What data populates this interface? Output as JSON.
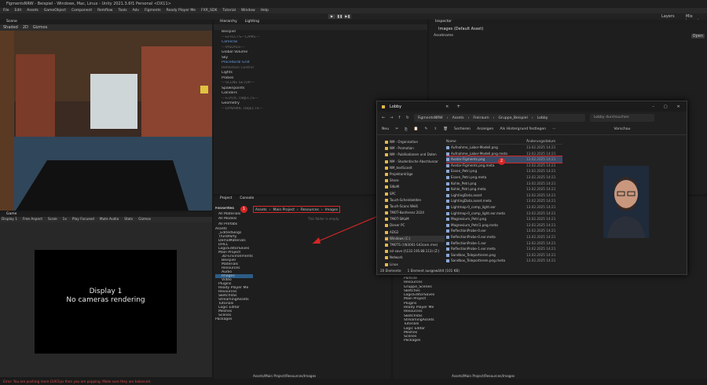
{
  "window": {
    "title": "FigmentsNRW - Beispiel - Windows, Mac, Linux - Unity 2021.3.6f1 Personal <DX11>"
  },
  "menu": [
    "File",
    "Edit",
    "Assets",
    "GameObject",
    "Component",
    "Remflow",
    "Tools",
    "Adv",
    "Figments",
    "Ready Player Me",
    "FXR_SDK",
    "Tutorial",
    "Window",
    "Help"
  ],
  "toolbar": {
    "layers_label": "Layers",
    "layout_label": "Mix Layout"
  },
  "scene": {
    "tab": "Scene",
    "toolbar_items": [
      "Shaded",
      "2D",
      "Gizmos"
    ]
  },
  "game": {
    "tab": "Game",
    "display": "Display 1",
    "aspect": "Free Aspect",
    "scale_label": "Scale",
    "scale_value": "1x",
    "options": [
      "Play Focused",
      "Mute Audio",
      "Stats",
      "Gizmos"
    ],
    "message_line1": "Display 1",
    "message_line2": "No cameras rendering"
  },
  "hierarchy": {
    "tab": "Hierarchy",
    "tab2": "Lighting",
    "items": [
      {
        "label": "Beispiel",
        "cls": ""
      },
      {
        "label": "---EFFECTS---CAMS---",
        "cls": "muted"
      },
      {
        "label": "Cameras",
        "cls": "blue"
      },
      {
        "label": "---VISUALS---",
        "cls": "muted"
      },
      {
        "label": "Global Volume",
        "cls": ""
      },
      {
        "label": "Sky",
        "cls": ""
      },
      {
        "label": "Procedural Grid",
        "cls": "blue"
      },
      {
        "label": "Reflection Control",
        "cls": "muted"
      },
      {
        "label": "Lights",
        "cls": ""
      },
      {
        "label": "Probes",
        "cls": ""
      },
      {
        "label": "---SCENE SETUP---",
        "cls": "muted"
      },
      {
        "label": "Spawnpoints",
        "cls": ""
      },
      {
        "label": "Colliders",
        "cls": ""
      },
      {
        "label": "---STATIC OBJECTS---",
        "cls": "muted"
      },
      {
        "label": "Geometry",
        "cls": ""
      },
      {
        "label": "---DYNAMIC OBJECTS---",
        "cls": "muted"
      }
    ]
  },
  "inspector": {
    "tab": "Inspector",
    "asset_title": "Images (Default Asset)",
    "open_button": "Open",
    "sub_label": "Assetname"
  },
  "project": {
    "tab": "Project",
    "tab2": "Console",
    "favorites_label": "Favorites",
    "favorites": [
      "All Materials",
      "All Models",
      "All Prefabs"
    ],
    "tree": [
      "Assets",
      "_EditedSlogs",
      "ThirdParty",
      "DemoMaterials",
      "DHLL",
      "LogicEditorSaves",
      "Main Project",
      "3D-Environments",
      "Beispiel",
      "Materials",
      "Resources",
      "Audio",
      "Images",
      "Video",
      "Plugins",
      "Ready Player Me",
      "Resources",
      "SketchVas",
      "StreamingAssets",
      "Tutorials",
      "Logic Editor",
      "Meshes",
      "Scenes",
      "Packages"
    ],
    "breadcrumb": [
      "Assets",
      "Main Project",
      "Resources",
      "Images"
    ],
    "empty_msg": "This folder is empty",
    "status_path": "Assets/Main Project/Resources/Images"
  },
  "project2": {
    "tree": [
      "Particle",
      "Resources",
      "Gruppe_Scenes",
      "Sketches",
      "LogicEditorSaves",
      "Main Project",
      "Plugins",
      "Ready Player Me",
      "Resources",
      "SketchVas",
      "StreamingAssets",
      "Tutorials",
      "Logic Editor",
      "Meshes",
      "Scenes",
      "Packages"
    ],
    "status_path": "Assets/Main Project/Resources/Images"
  },
  "explorer": {
    "tab_title": "Lobby",
    "path": [
      "FigmentsNRW",
      "Assets",
      "Freiraum",
      "Gruppe_Beispiel",
      "Lobby"
    ],
    "search_placeholder": "Lobby durchsuchen",
    "new_label": "Neu",
    "sort_label": "Sortieren",
    "view_label": "Anzeigen",
    "wallpaper_label": "Als Hintergrund festlegen",
    "preview_label": "Vorschau",
    "col_name": "Name",
    "col_date": "Änderungsdatum",
    "sidebar": [
      "NM - Organisation",
      "NM - Promotion",
      "NM - Publikationen und Daten",
      "NM - Studentische Abschlussar",
      "NM_textScanlt",
      "Projektanträge",
      "Share",
      "SIKoM",
      "SPC",
      "Tauch-Scheinbelden",
      "Tauch-Scans Weiß",
      "TMOT-Konferenz 2024",
      "TMOT-SIKoM",
      "Dieser PC",
      "ADG2",
      "Windows (C:)",
      "TMOTS (\\\\N3001-S43cam.rme)",
      "ssl-save (\\\\132.195.88.113) (Z:)",
      "Network",
      "Linux"
    ],
    "files": [
      {
        "name": "Aufnahme_Labor-Modell.png",
        "date": "13.02.2025 14:21"
      },
      {
        "name": "Aufnahme_Labor-Modell.png.meta",
        "date": "13.02.2025 14:21"
      },
      {
        "name": "Avatar-Figments.png",
        "date": "13.02.2025 14:21"
      },
      {
        "name": "Avatar-Figments.png.meta",
        "date": "13.02.2025 14:21"
      },
      {
        "name": "Essen_Petri.png",
        "date": "13.02.2025 14:21"
      },
      {
        "name": "Essen_Petri.png.meta",
        "date": "13.02.2025 14:21"
      },
      {
        "name": "Kohle_Petri.png",
        "date": "13.02.2025 14:21"
      },
      {
        "name": "Kohle_Petri.png.meta",
        "date": "13.02.2025 14:21"
      },
      {
        "name": "LightingData.asset",
        "date": "13.02.2025 14:21"
      },
      {
        "name": "LightingData.asset.meta",
        "date": "13.02.2025 14:21"
      },
      {
        "name": "Lightmap-0_comp_light.exr",
        "date": "13.02.2025 14:21"
      },
      {
        "name": "Lightmap-0_comp_light.exr.meta",
        "date": "13.02.2025 14:21"
      },
      {
        "name": "Magnesium_Petri.png",
        "date": "13.02.2025 14:21"
      },
      {
        "name": "Magnesium_Petri1.png.meta",
        "date": "13.02.2025 14:21"
      },
      {
        "name": "ReflectionProbe-0.exr",
        "date": "13.02.2025 14:21"
      },
      {
        "name": "ReflectionProbe-0.exr.meta",
        "date": "13.02.2025 14:21"
      },
      {
        "name": "ReflectionProbe-1.exr",
        "date": "13.02.2025 14:21"
      },
      {
        "name": "ReflectionProbe-1.exr.meta",
        "date": "13.02.2025 14:21"
      },
      {
        "name": "Sandbox_Teleportieren.png",
        "date": "13.02.2025 14:21"
      },
      {
        "name": "Sandbox_Teleportieren.png.meta",
        "date": "13.02.2025 14:21"
      }
    ],
    "status_count": "20 Elemente",
    "status_selected": "1 Element ausgewählt (101 KB)"
  },
  "console": {
    "error": "Error: You are pushing more GUIClips than you are popping. Make sure they are balanced."
  },
  "badges": [
    "1",
    "2"
  ],
  "colors": {
    "accent": "#3b7bd8",
    "badge": "#d62626",
    "error": "#d84a4a"
  }
}
